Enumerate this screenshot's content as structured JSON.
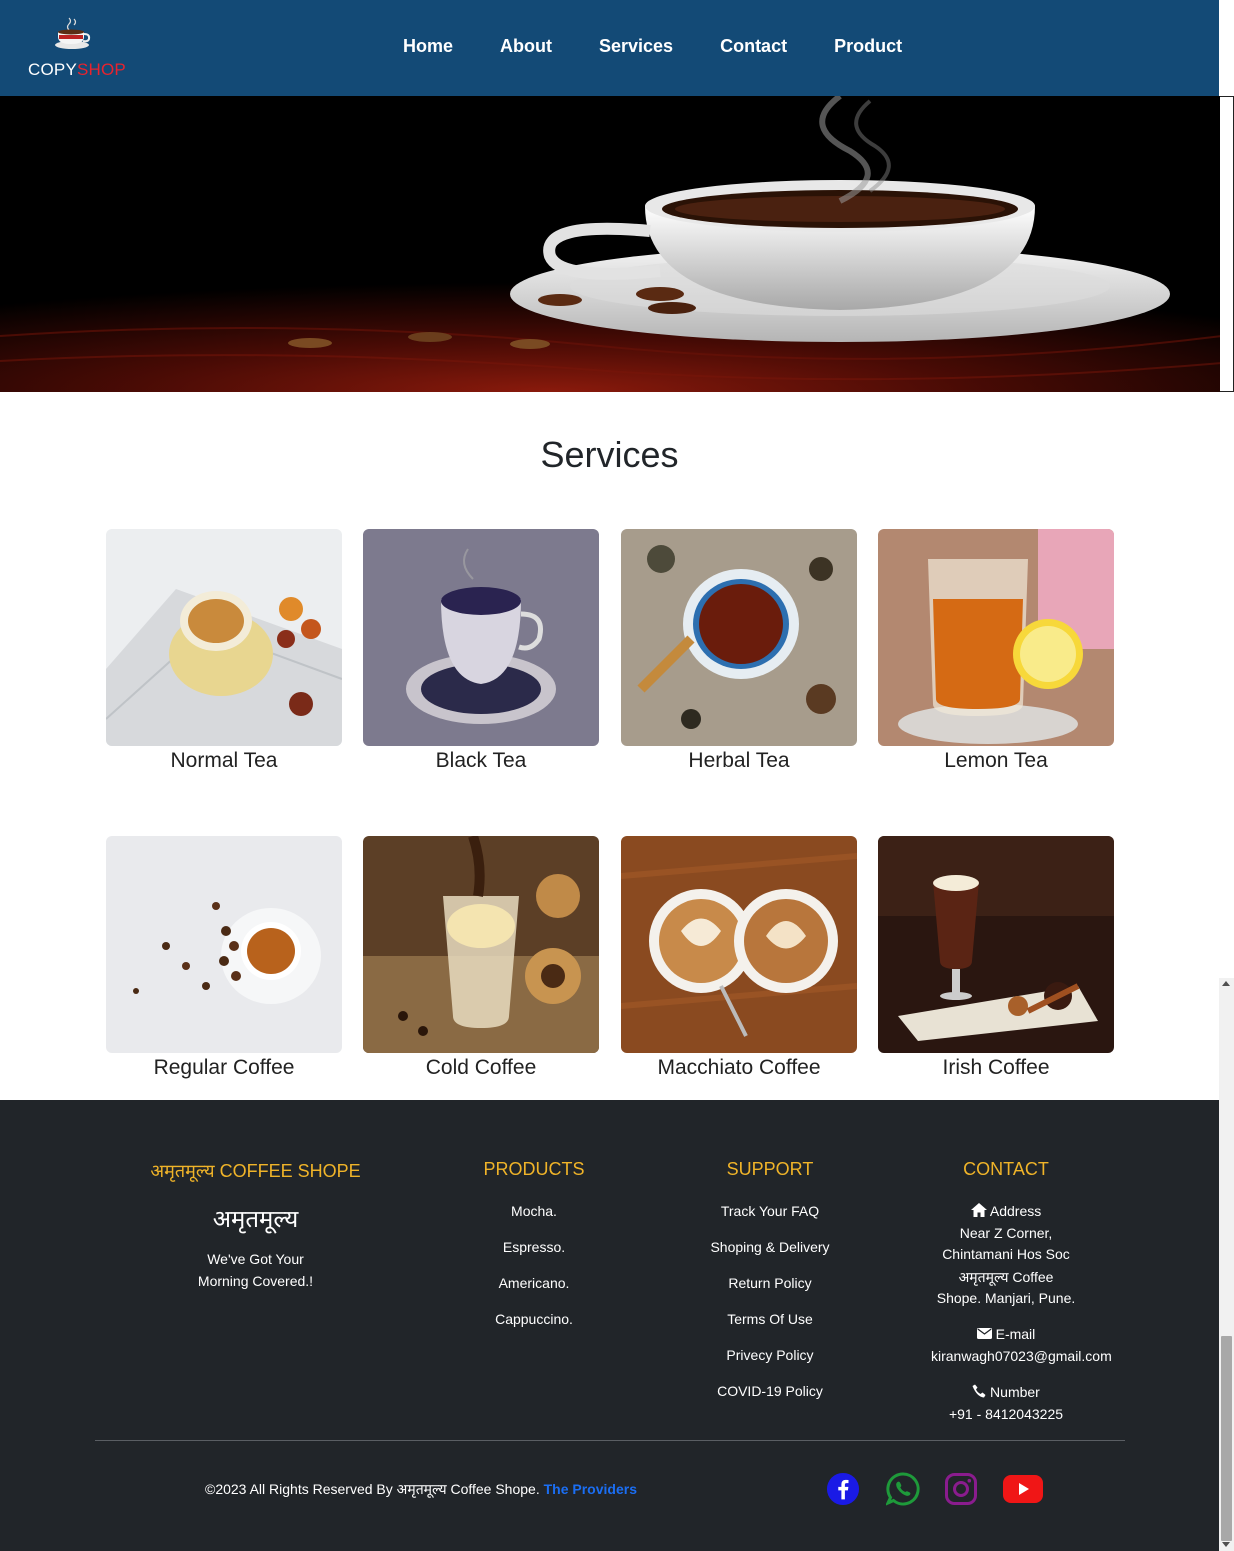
{
  "logo": {
    "text_main": "COPY",
    "text_accent": "SHOP",
    "icon": "coffee-cup-icon"
  },
  "nav": {
    "items": [
      "Home",
      "About",
      "Services",
      "Contact",
      "Product"
    ]
  },
  "services": {
    "title": "Services",
    "cards": [
      {
        "label": "Normal Tea"
      },
      {
        "label": "Black Tea"
      },
      {
        "label": "Herbal Tea"
      },
      {
        "label": "Lemon Tea"
      },
      {
        "label": "Regular Coffee"
      },
      {
        "label": "Cold Coffee"
      },
      {
        "label": "Macchiato Coffee"
      },
      {
        "label": "Irish Coffee"
      }
    ]
  },
  "footer": {
    "col1": {
      "title": "अमृतमूल्य COFFEE SHOPE",
      "brand": "अमृतमूल्य",
      "tagline_1": "We've Got Your",
      "tagline_2": "Morning Covered.!"
    },
    "col2": {
      "title": "PRODUCTS",
      "items": [
        "Mocha.",
        "Espresso.",
        "Americano.",
        "Cappuccino."
      ]
    },
    "col3": {
      "title": "SUPPORT",
      "items": [
        "Track Your FAQ",
        "Shoping & Delivery",
        "Return Policy",
        "Terms Of Use",
        "Privecy Policy",
        "COVID-19 Policy"
      ]
    },
    "col4": {
      "title": "CONTACT",
      "address_label": "Address",
      "address_lines": [
        "Near Z Corner,",
        "Chintamani Hos Soc",
        "अमृतमूल्य Coffee",
        "Shope. Manjari, Pune."
      ],
      "email_label": "E-mail",
      "email": "kiranwagh07023@gmail.com",
      "number_label": "Number",
      "number": "+91 - 8412043225"
    },
    "copyright": "©2023 All Rights Reserved By अमृतमूल्य Coffee Shope.",
    "providers": "The Providers",
    "social_icons": [
      "facebook-icon",
      "whatsapp-icon",
      "instagram-icon",
      "youtube-icon"
    ]
  },
  "colors": {
    "navbar": "#134a76",
    "footer_bg": "#212529",
    "footer_heading": "#f0b429",
    "link_blue": "#1b6ef3",
    "shop_red": "#e8232e"
  }
}
